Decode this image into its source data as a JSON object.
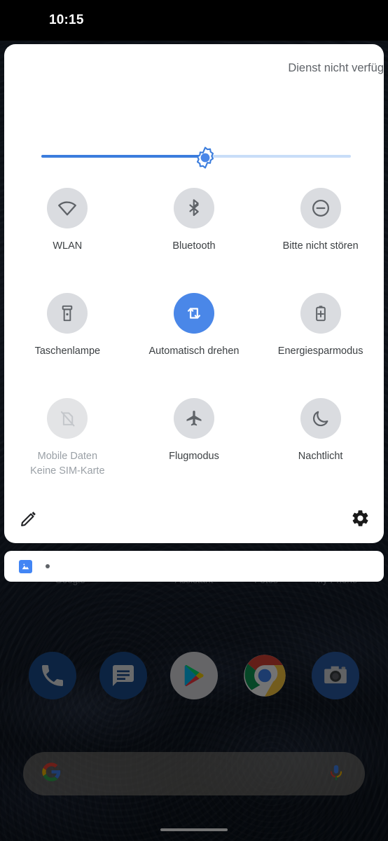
{
  "status_bar": {
    "time": "10:15"
  },
  "quick_settings": {
    "service_status": "Dienst nicht verfüg",
    "brightness": {
      "icon": "brightness-sun-icon",
      "value_percent": 52
    },
    "accent_color": "#4a87e8",
    "tile_off_color": "#dadce0",
    "tiles": [
      {
        "label": "WLAN",
        "icon": "wifi-icon",
        "active": false,
        "disabled": false,
        "sublabel": ""
      },
      {
        "label": "Bluetooth",
        "icon": "bluetooth-icon",
        "active": false,
        "disabled": false,
        "sublabel": ""
      },
      {
        "label": "Bitte nicht stören",
        "icon": "do-not-disturb-icon",
        "active": false,
        "disabled": false,
        "sublabel": ""
      },
      {
        "label": "Taschenlampe",
        "icon": "flashlight-icon",
        "active": false,
        "disabled": false,
        "sublabel": ""
      },
      {
        "label": "Automatisch drehen",
        "icon": "auto-rotate-icon",
        "active": true,
        "disabled": false,
        "sublabel": ""
      },
      {
        "label": "Energiesparmodus",
        "icon": "battery-saver-icon",
        "active": false,
        "disabled": false,
        "sublabel": ""
      },
      {
        "label": "Mobile Daten",
        "icon": "sim-card-off-icon",
        "active": false,
        "disabled": true,
        "sublabel": "Keine SIM-Karte"
      },
      {
        "label": "Flugmodus",
        "icon": "airplane-icon",
        "active": false,
        "disabled": false,
        "sublabel": ""
      },
      {
        "label": "Nachtlicht",
        "icon": "moon-icon",
        "active": false,
        "disabled": false,
        "sublabel": ""
      }
    ],
    "footer": {
      "edit_icon": "pencil-edit-icon",
      "settings_icon": "gear-settings-icon"
    }
  },
  "notification_shade": {
    "app_icon": "photos-image-icon",
    "overflow_dot": "notification-dot"
  },
  "home_screen": {
    "app_labels": [
      "Google",
      "Assistant",
      "Fotos",
      "My Phone"
    ],
    "dock": [
      {
        "name": "Phone",
        "icon": "phone-icon"
      },
      {
        "name": "Messages",
        "icon": "messages-icon"
      },
      {
        "name": "Play Store",
        "icon": "play-store-icon"
      },
      {
        "name": "Chrome",
        "icon": "chrome-icon"
      },
      {
        "name": "Camera",
        "icon": "camera-icon"
      }
    ],
    "search": {
      "logo_icon": "google-g-icon",
      "mic_icon": "microphone-icon",
      "placeholder": ""
    },
    "gesture_bar": "home-gesture-bar"
  }
}
